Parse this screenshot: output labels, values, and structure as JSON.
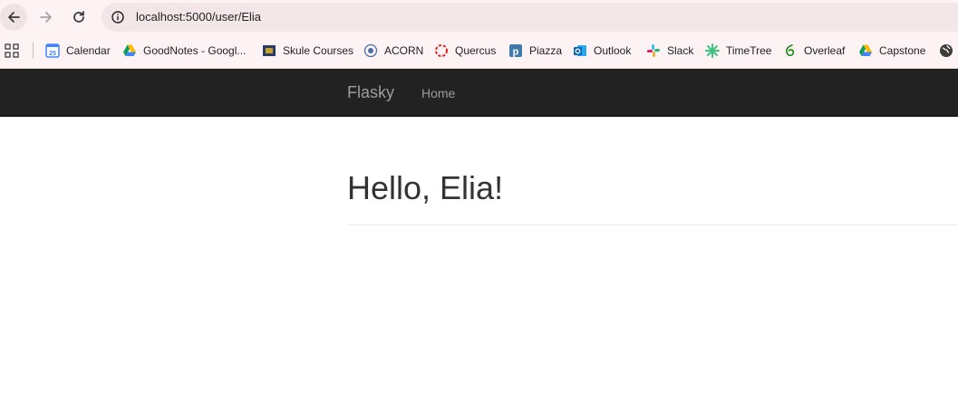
{
  "browser": {
    "url": "localhost:5000/user/Elia"
  },
  "bookmarks": [
    {
      "label": "Calendar",
      "icon": "google-calendar-icon"
    },
    {
      "label": "GoodNotes - Googl...",
      "icon": "google-drive-icon"
    },
    {
      "label": "Skule Courses",
      "icon": "skule-courses-icon"
    },
    {
      "label": "ACORN",
      "icon": "acorn-icon"
    },
    {
      "label": "Quercus",
      "icon": "quercus-icon"
    },
    {
      "label": "Piazza",
      "icon": "piazza-icon"
    },
    {
      "label": "Outlook",
      "icon": "outlook-icon"
    },
    {
      "label": "Slack",
      "icon": "slack-icon"
    },
    {
      "label": "TimeTree",
      "icon": "timetree-icon"
    },
    {
      "label": "Overleaf",
      "icon": "overleaf-icon"
    },
    {
      "label": "Capstone",
      "icon": "google-drive-icon"
    },
    {
      "label": "",
      "icon": "globe-icon"
    }
  ],
  "calendar_icon_day": "25",
  "navbar": {
    "brand": "Flasky",
    "home": "Home"
  },
  "page": {
    "heading": "Hello, Elia!"
  },
  "colors": {
    "browser_chrome": "#fdf3f4",
    "address_bar": "#f3e6e8",
    "navbar_bg": "#222222",
    "navbar_text": "#9d9d9d",
    "heading_text": "#333333"
  }
}
